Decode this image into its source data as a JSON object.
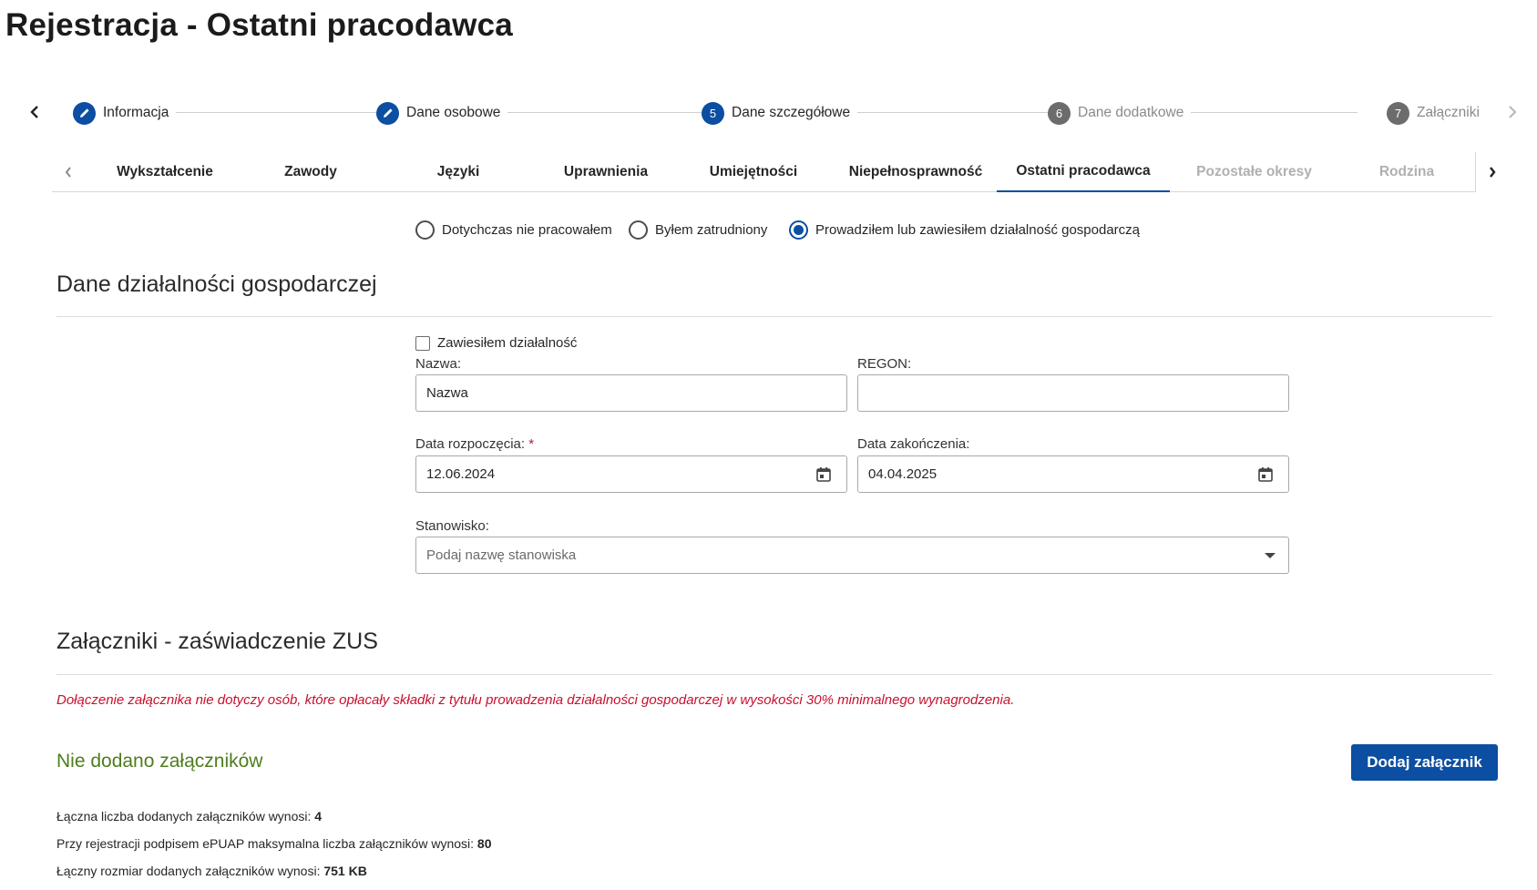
{
  "page": {
    "title": "Rejestracja - Ostatni pracodawca"
  },
  "stepper": {
    "steps": [
      {
        "label": "Informacja",
        "marker": "pencil-icon",
        "state": "done"
      },
      {
        "label": "Dane osobowe",
        "marker": "pencil-icon",
        "state": "done"
      },
      {
        "label": "Dane szczegółowe",
        "number": "5",
        "state": "current"
      },
      {
        "label": "Dane dodatkowe",
        "number": "6",
        "state": "disabled"
      },
      {
        "label": "Załączniki",
        "number": "7",
        "state": "disabled"
      }
    ]
  },
  "tabs": {
    "items": [
      {
        "label": "Wykształcenie"
      },
      {
        "label": "Zawody"
      },
      {
        "label": "Języki"
      },
      {
        "label": "Uprawnienia"
      },
      {
        "label": "Umiejętności"
      },
      {
        "label": "Niepełnosprawność"
      },
      {
        "label": "Ostatni pracodawca",
        "active": true
      },
      {
        "label": "Pozostałe okresy",
        "muted": true
      },
      {
        "label": "Rodzina",
        "muted": true
      }
    ]
  },
  "employment": {
    "options": [
      {
        "label": "Dotychczas nie pracowałem",
        "selected": false
      },
      {
        "label": "Byłem zatrudniony",
        "selected": false
      },
      {
        "label": "Prowadziłem lub zawiesiłem działalność gospodarczą",
        "selected": true
      }
    ]
  },
  "business": {
    "section_title": "Dane działalności gospodarczej",
    "suspended_label": "Zawiesiłem działalność",
    "suspended_checked": false,
    "name_label": "Nazwa:",
    "name_value": "Nazwa",
    "regon_label": "REGON:",
    "regon_value": "",
    "start_label": "Data rozpoczęcia:",
    "required_mark": "*",
    "start_value": "12.06.2024",
    "end_label": "Data zakończenia:",
    "end_value": "04.04.2025",
    "position_label": "Stanowisko:",
    "position_placeholder": "Podaj nazwę stanowiska"
  },
  "attachments": {
    "section_title": "Załączniki - zaświadczenie ZUS",
    "note": "Dołączenie załącznika nie dotyczy osób, które opłacały składki z tytułu prowadzenia działalności gospodarczej w wysokości 30% minimalnego wynagrodzenia.",
    "empty_message": "Nie dodano załączników",
    "add_button": "Dodaj załącznik",
    "stats": [
      {
        "label": "Łączna liczba dodanych załączników wynosi: ",
        "value": "4"
      },
      {
        "label": "Przy rejestracji podpisem ePUAP maksymalna liczba załączników wynosi: ",
        "value": "80"
      },
      {
        "label": "Łączny rozmiar dodanych załączników wynosi: ",
        "value": "751 KB"
      }
    ]
  },
  "colors": {
    "primary": "#0b4ea2",
    "disabled_step": "#6c6c6c",
    "error_text": "#c8102e",
    "success_text": "#4f7d1e"
  }
}
